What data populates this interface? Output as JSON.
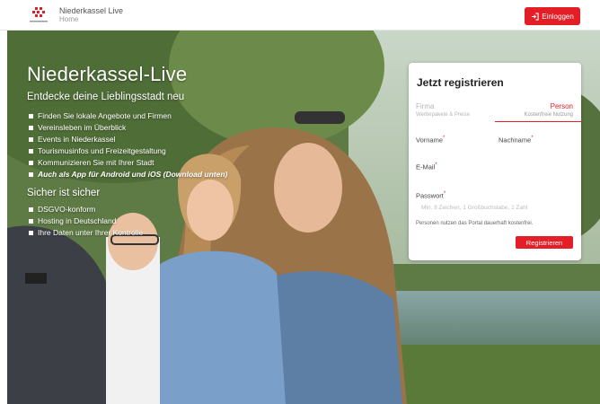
{
  "header": {
    "brand_title": "Niederkassel Live",
    "breadcrumb": "Home",
    "login_label": "Einloggen",
    "accent_color": "#e41e26"
  },
  "hero": {
    "title": "Niederkassel-Live",
    "subtitle": "Entdecke deine Lieblingsstadt neu",
    "features": [
      "Finden Sie lokale Angebote und Firmen",
      "Vereinsleben im Überblick",
      "Events in Niederkassel",
      "Tourismusinfos und Freizeitgestaltung",
      "Kommunizieren Sie mit Ihrer Stadt",
      "Auch als App für Android und iOS (Download unten)"
    ],
    "secure_title": "Sicher ist sicher",
    "secure_items": [
      "DSGVO-konform",
      "Hosting in Deutschland",
      "Ihre Daten unter Ihrer Kontrolle"
    ]
  },
  "register": {
    "title": "Jetzt registrieren",
    "tab_firma": "Firma",
    "tab_firma_sub": "Werbepakete & Preise",
    "tab_person": "Person",
    "tab_person_sub": "Kostenfreie Nutzung",
    "vorname_label": "Vorname",
    "nachname_label": "Nachname",
    "email_label": "E-Mail",
    "passwort_label": "Passwort",
    "required_mark": "*",
    "password_hint": "Min. 8 Zeichen, 1 Großbuchstabe, 1 Zahl",
    "note": "Personen nutzen das Portal dauerhaft kostenfrei.",
    "submit_label": "Registrieren"
  }
}
